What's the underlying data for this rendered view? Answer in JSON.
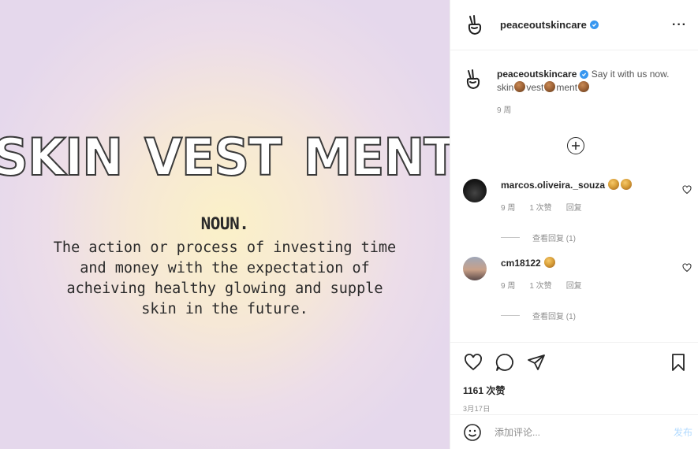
{
  "image": {
    "headline": [
      "SKIN",
      "VEST",
      "MENT"
    ],
    "noun_label": "NOUN.",
    "definition_lines": [
      "The action or process of investing time",
      "and money with the expectation of",
      "acheiving healthy glowing and supple",
      "skin in the future."
    ]
  },
  "header": {
    "username": "peaceoutskincare",
    "verified": true,
    "more_label": "···",
    "avatar_icon": "peace-hand-icon"
  },
  "caption": {
    "username": "peaceoutskincare",
    "text": " Say it with us now. skin",
    "text_part2": "vest",
    "text_part3": "ment",
    "time": "9 周"
  },
  "comments": [
    {
      "username": "marcos.oliveira._souza",
      "time": "9 周",
      "likes": "1 次赞",
      "reply_label": "回复",
      "view_replies": "查看回复 (1)"
    },
    {
      "username": "cm18122",
      "time": "9 周",
      "likes": "1 次赞",
      "reply_label": "回复",
      "view_replies": "查看回复 (1)"
    }
  ],
  "post_footer": {
    "likes": "1161 次赞",
    "date": "3月17日"
  },
  "add_comment": {
    "placeholder": "添加评论...",
    "post_label": "发布"
  },
  "colors": {
    "verified": "#3897f0",
    "post_button": "#b3dbff",
    "muted_text": "#8e8e8e"
  }
}
